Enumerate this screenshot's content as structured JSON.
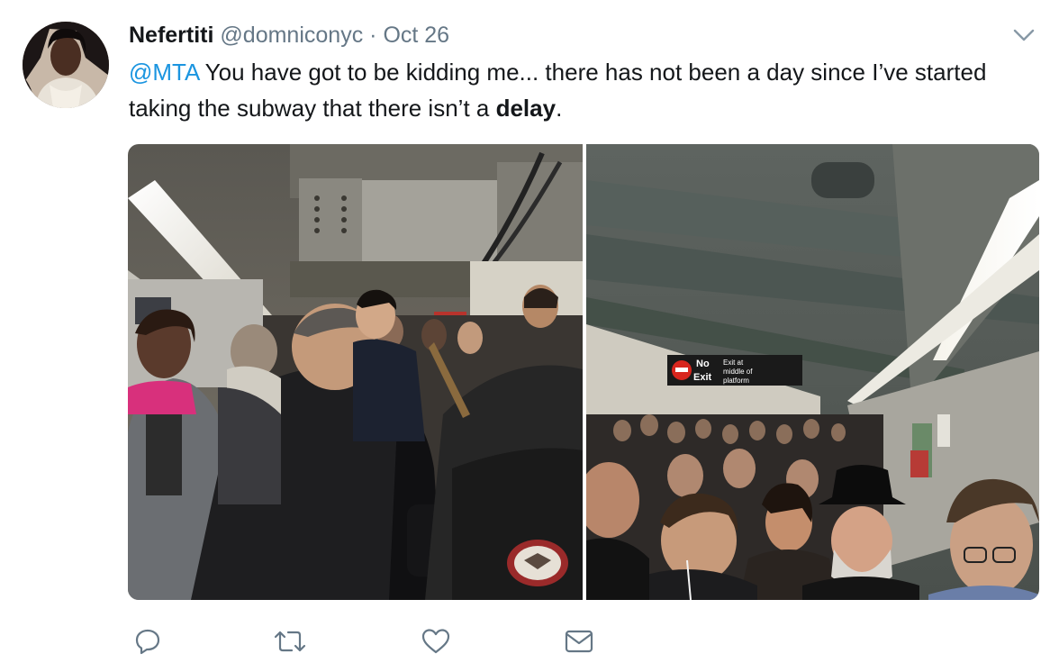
{
  "tweet": {
    "author_name": "Nefertiti",
    "handle": "@domniconyc",
    "separator": "·",
    "date": "Oct 26",
    "text": {
      "mention": "@MTA",
      "part1": " You have got to be kidding me... there has not been a day since I’ve started taking the subway that there isn’t a ",
      "bold_word": "delay",
      "part2": "."
    }
  },
  "media": {
    "right_photo_sign": {
      "no_exit_line1": "No",
      "no_exit_line2": "Exit",
      "exit_line1": "Exit at",
      "exit_line2": "middle of",
      "exit_line3": "platform"
    },
    "backpack_brand": "OSPREY"
  },
  "icons": {
    "caret": "chevron-down-icon",
    "reply": "reply-icon",
    "retweet": "retweet-icon",
    "like": "heart-icon",
    "dm": "envelope-icon"
  },
  "colors": {
    "link": "#1b95e0",
    "text": "#14171a",
    "secondary": "#657786",
    "icon": "#657786"
  }
}
